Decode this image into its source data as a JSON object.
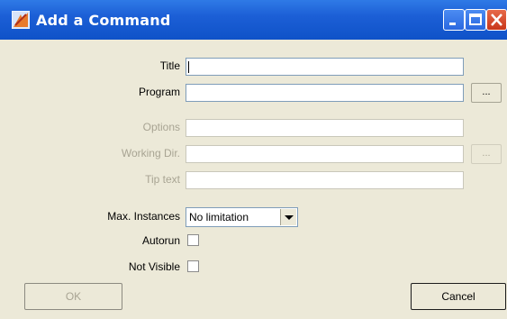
{
  "window": {
    "title": "Add a Command"
  },
  "icons": {
    "app": "app-icon",
    "minimize": "minimize-icon",
    "maximize": "maximize-icon",
    "close": "close-icon"
  },
  "form": {
    "title_label": "Title",
    "title_value": "",
    "program_label": "Program",
    "program_value": "",
    "browse_label": "...",
    "options_label": "Options",
    "options_value": "",
    "working_dir_label": "Working Dir.",
    "working_dir_value": "",
    "tip_text_label": "Tip text",
    "tip_text_value": "",
    "max_instances_label": "Max. Instances",
    "max_instances_value": "No limitation",
    "autorun_label": "Autorun",
    "autorun_checked": false,
    "not_visible_label": "Not Visible",
    "not_visible_checked": false
  },
  "buttons": {
    "ok": "OK",
    "cancel": "Cancel"
  },
  "colors": {
    "titlebar": "#1c5fd6",
    "client_bg": "#ece9d8",
    "disabled_text": "#a8a493"
  }
}
